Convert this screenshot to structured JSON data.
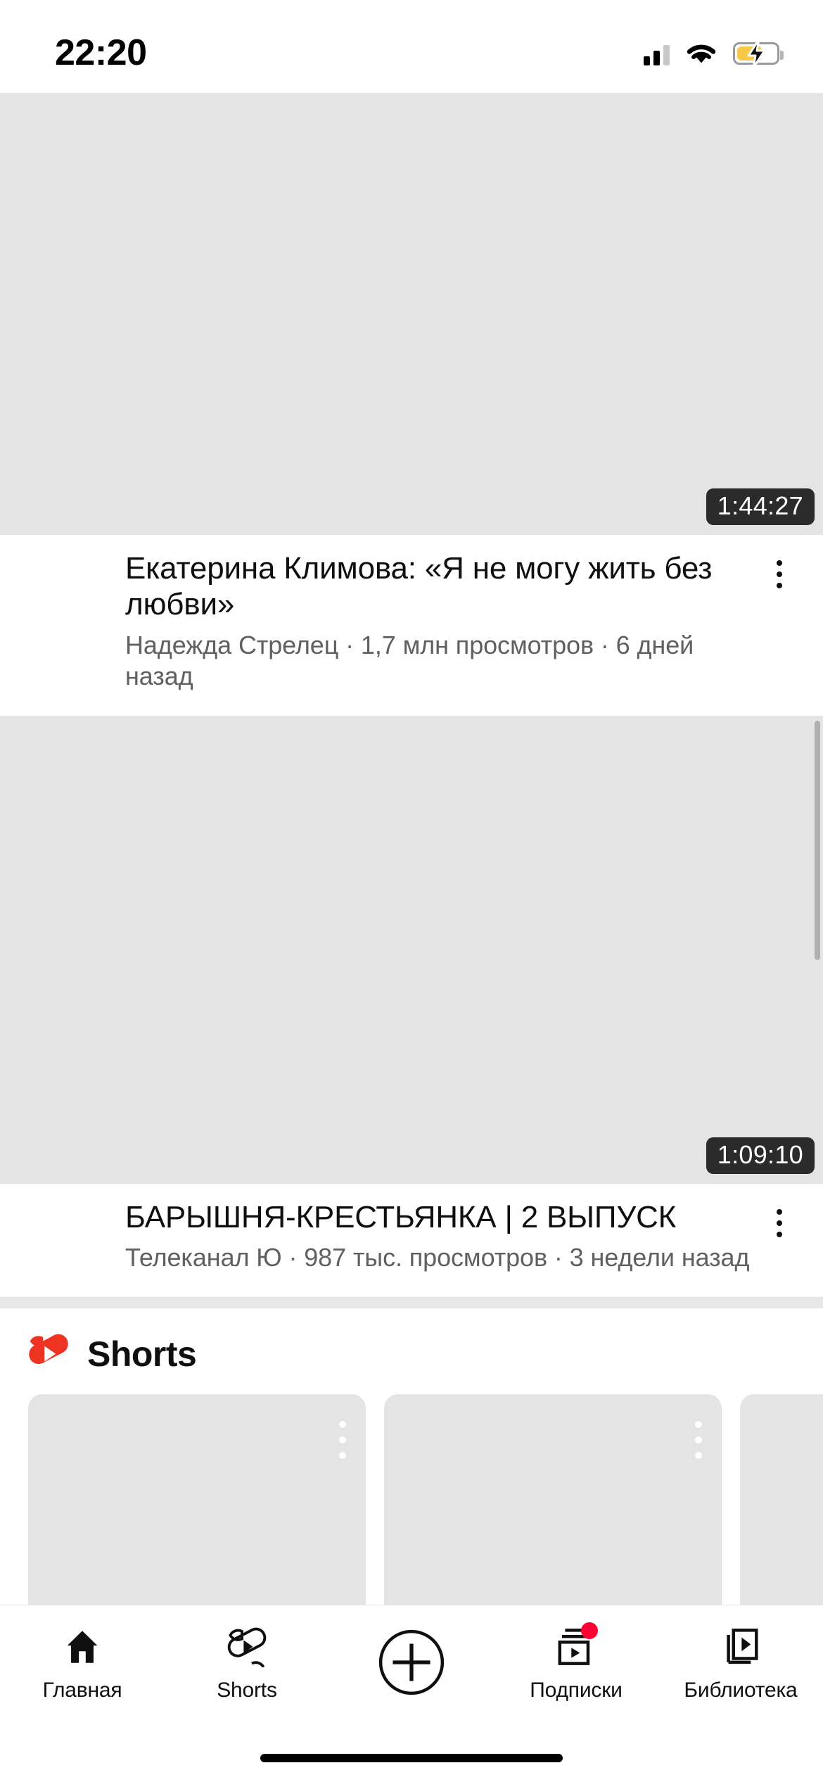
{
  "status_bar": {
    "time": "22:20",
    "icons": [
      "cellular-signal-icon",
      "wifi-icon",
      "battery-charging-icon"
    ],
    "battery_color": "#f7c948"
  },
  "feed": {
    "videos": [
      {
        "duration": "1:44:27",
        "title": "Екатерина Климова: «Я не могу жить без любви»",
        "meta": "Надежда Стрелец · 1,7 млн просмотров · 6 дней назад",
        "channel": "Надежда Стрелец",
        "views": "1,7 млн просмотров",
        "age": "6 дней назад"
      },
      {
        "duration": "1:09:10",
        "title": "БАРЫШНЯ-КРЕСТЬЯНКА | 2 ВЫПУСК",
        "meta": "Телеканал Ю · 987 тыс. просмотров · 3 недели назад",
        "channel": "Телеканал Ю",
        "views": "987 тыс. просмотров",
        "age": "3 недели назад"
      }
    ],
    "shorts_section": {
      "title": "Shorts",
      "logo_color": "#ee3322",
      "cards": 3
    }
  },
  "bottom_nav": {
    "items": [
      {
        "label": "Главная",
        "icon": "home-icon",
        "active": true,
        "badge": false
      },
      {
        "label": "Shorts",
        "icon": "shorts-icon",
        "active": false,
        "badge": false
      },
      {
        "label": "",
        "icon": "create-plus-icon",
        "active": false,
        "badge": false
      },
      {
        "label": "Подписки",
        "icon": "subscriptions-icon",
        "active": false,
        "badge": true
      },
      {
        "label": "Библиотека",
        "icon": "library-icon",
        "active": false,
        "badge": false
      }
    ]
  },
  "colors": {
    "accent_red": "#ff0033",
    "text_primary": "#0f0f0f",
    "text_secondary": "#606060",
    "placeholder": "#e4e4e4"
  }
}
